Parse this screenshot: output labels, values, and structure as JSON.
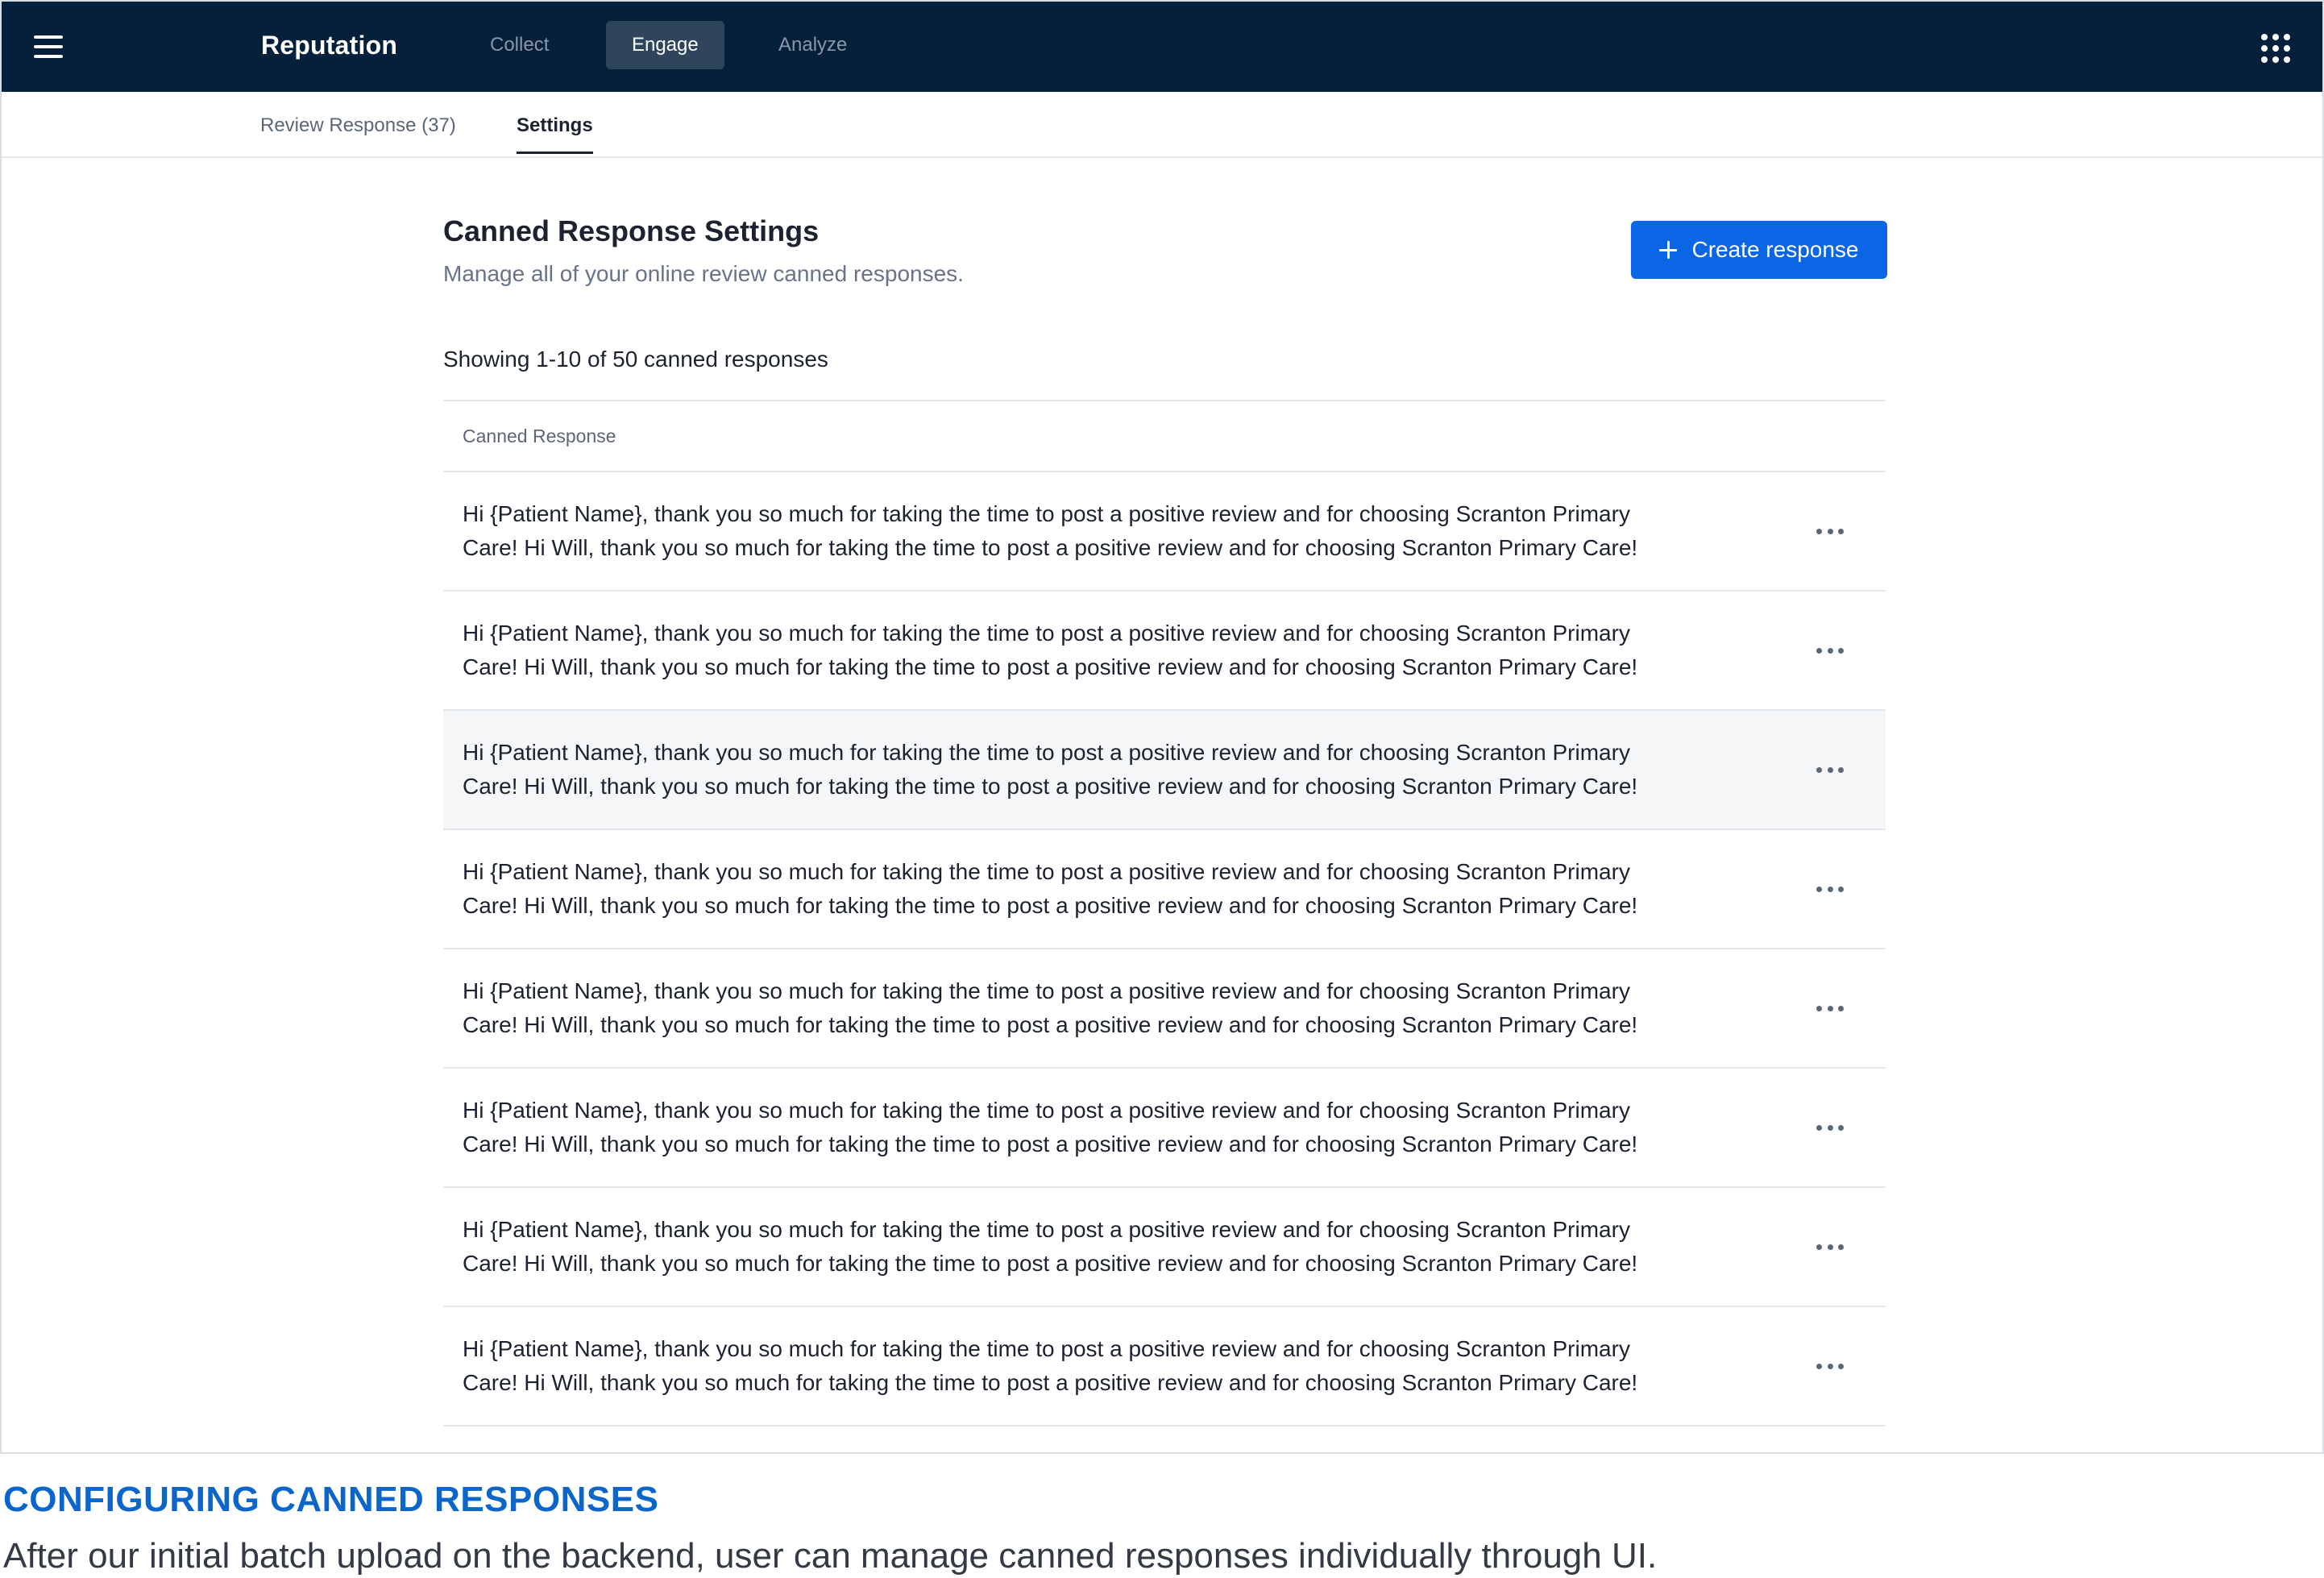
{
  "topbar": {
    "brand": "Reputation",
    "tabs": [
      {
        "label": "Collect",
        "active": false
      },
      {
        "label": "Engage",
        "active": true
      },
      {
        "label": "Analyze",
        "active": false
      }
    ],
    "menu_icon": "hamburger-menu-icon",
    "apps_icon": "apps-grid-icon",
    "background": "#05203a"
  },
  "subtabs": [
    {
      "label": "Review Response (37)",
      "active": false
    },
    {
      "label": "Settings",
      "active": true
    }
  ],
  "header": {
    "title": "Canned Response Settings",
    "subtitle": "Manage all of your online review canned responses.",
    "create_button": "Create response",
    "create_icon": "plus-icon",
    "accent": "#0a66e4"
  },
  "list": {
    "summary": "Showing 1-10 of 50 canned responses",
    "column_header": "Canned Response",
    "more_icon": "more-horizontal-icon",
    "rows": [
      {
        "line1": "Hi {Patient Name}, thank you so much for taking the time to post a positive review and for choosing Scranton Primary",
        "line2": "Care! Hi Will, thank you so much for taking the time to post a positive review and for choosing Scranton Primary Care!"
      },
      {
        "line1": "Hi {Patient Name}, thank you so much for taking the time to post a positive review and for choosing Scranton Primary",
        "line2": "Care! Hi Will, thank you so much for taking the time to post a positive review and for choosing Scranton Primary Care!"
      },
      {
        "line1": "Hi {Patient Name}, thank you so much for taking the time to post a positive review and for choosing Scranton Primary",
        "line2": "Care! Hi Will, thank you so much for taking the time to post a positive review and for choosing Scranton Primary Care!"
      },
      {
        "line1": "Hi {Patient Name}, thank you so much for taking the time to post a positive review and for choosing Scranton Primary",
        "line2": "Care! Hi Will, thank you so much for taking the time to post a positive review and for choosing Scranton Primary Care!"
      },
      {
        "line1": "Hi {Patient Name}, thank you so much for taking the time to post a positive review and for choosing Scranton Primary",
        "line2": "Care! Hi Will, thank you so much for taking the time to post a positive review and for choosing Scranton Primary Care!"
      },
      {
        "line1": "Hi {Patient Name}, thank you so much for taking the time to post a positive review and for choosing Scranton Primary",
        "line2": "Care! Hi Will, thank you so much for taking the time to post a positive review and for choosing Scranton Primary Care!"
      },
      {
        "line1": "Hi {Patient Name}, thank you so much for taking the time to post a positive review and for choosing Scranton Primary",
        "line2": "Care! Hi Will, thank you so much for taking the time to post a positive review and for choosing Scranton Primary Care!"
      },
      {
        "line1": "Hi {Patient Name}, thank you so much for taking the time to post a positive review and for choosing Scranton Primary",
        "line2": "Care! Hi Will, thank you so much for taking the time to post a positive review and for choosing Scranton Primary Care!"
      }
    ]
  },
  "caption": {
    "title": "CONFIGURING CANNED RESPONSES",
    "body": "After our initial batch upload on the backend, user can manage canned responses individually through UI.",
    "title_color": "#0a66c8"
  }
}
